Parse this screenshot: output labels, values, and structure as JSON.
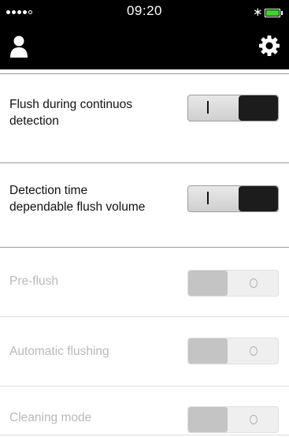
{
  "status_bar": {
    "time": "09:20",
    "signal_icon": "signal-dots-icon",
    "bluetooth_icon": "bluetooth-icon",
    "battery_icon": "battery-icon",
    "battery_color": "#43d12f"
  },
  "header": {
    "user_icon": "user-icon",
    "settings_icon": "gear-icon",
    "background": "#000000"
  },
  "settings": [
    {
      "label": "Flush during continuos\ndetection",
      "state": "on",
      "enabled": true
    },
    {
      "label": "Detection time\ndependable flush volume",
      "state": "on",
      "enabled": true
    },
    {
      "label": "Pre-flush",
      "state": "off",
      "enabled": false
    },
    {
      "label": "Automatic flushing",
      "state": "off",
      "enabled": false
    },
    {
      "label": "Cleaning mode",
      "state": "off",
      "enabled": false
    }
  ]
}
